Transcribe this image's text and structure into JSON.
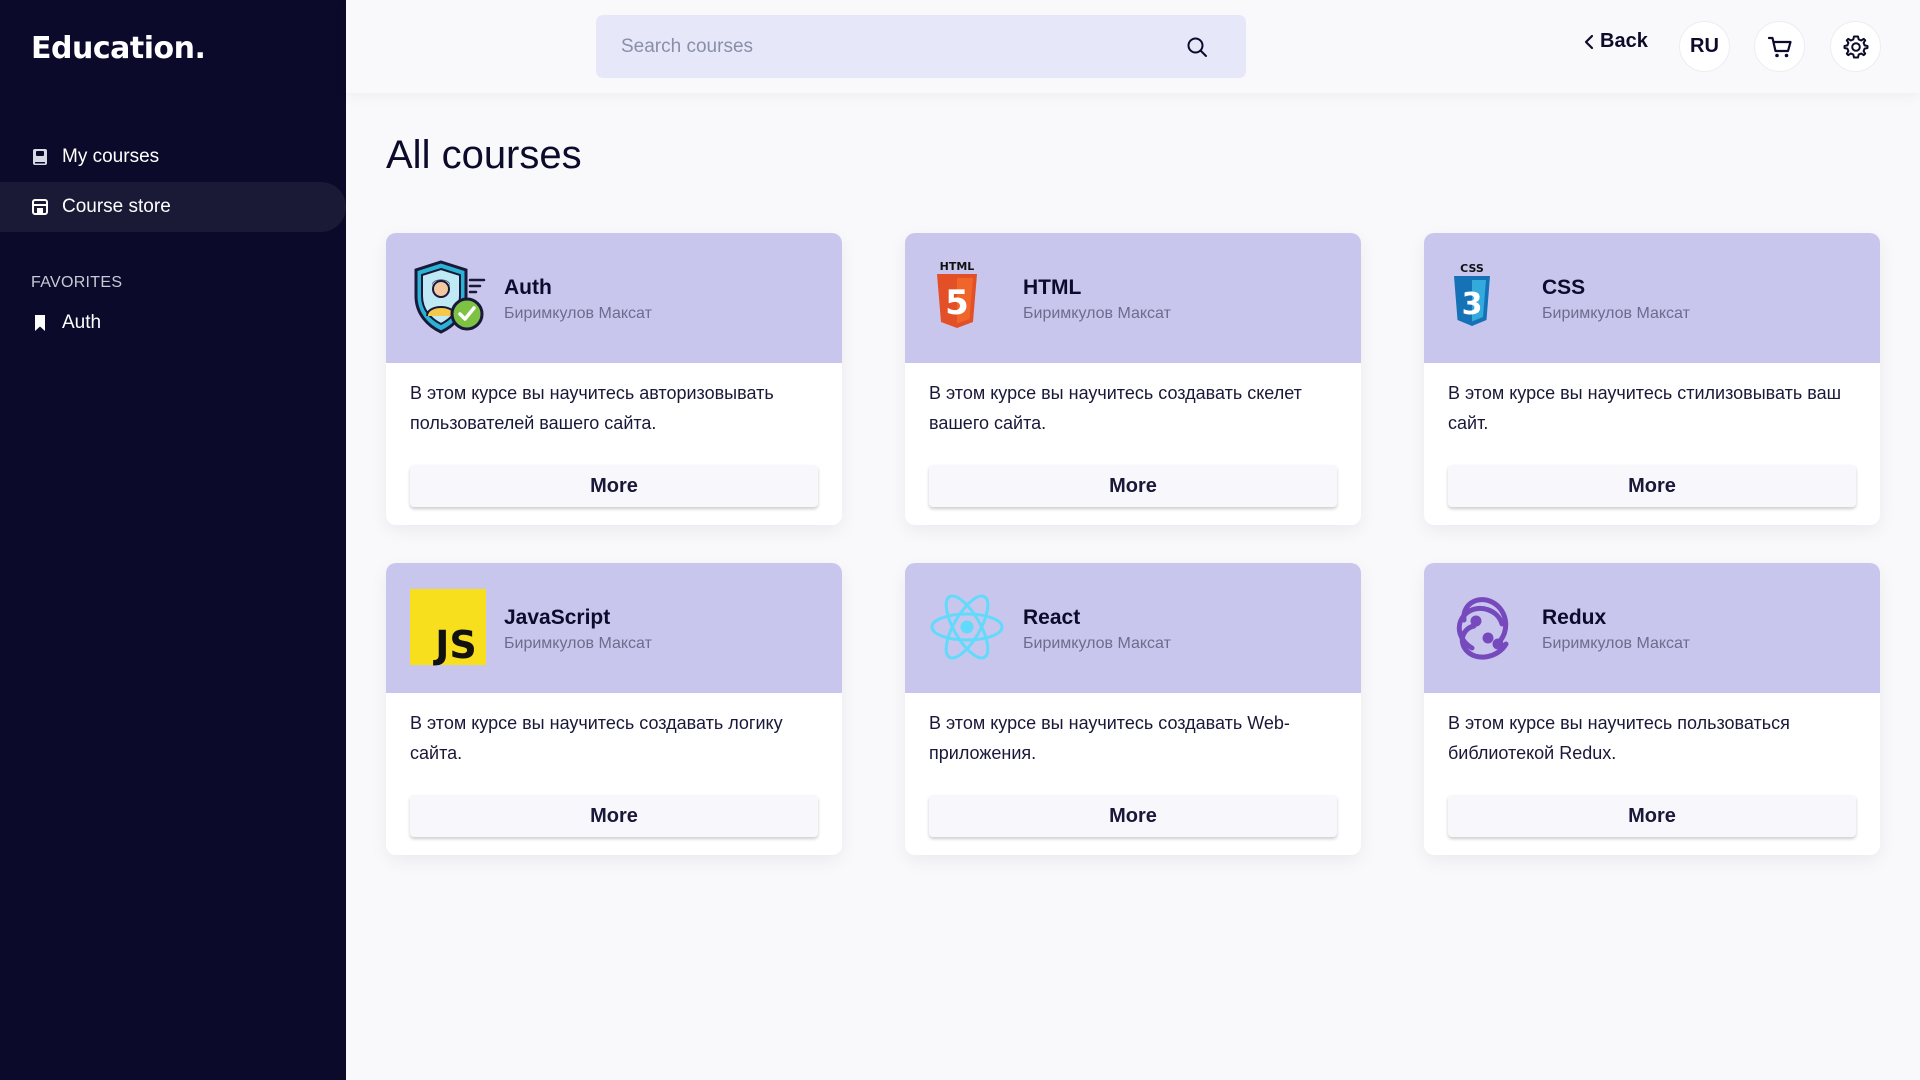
{
  "app": {
    "logo": "Education."
  },
  "sidebar": {
    "items": [
      {
        "label": "My courses",
        "icon": "book-icon"
      },
      {
        "label": "Course store",
        "icon": "store-icon",
        "active": true
      }
    ],
    "favorites_title": "FAVORITES",
    "favorites": [
      {
        "label": "Auth",
        "icon": "bookmark-icon"
      }
    ]
  },
  "header": {
    "search_placeholder": "Search courses",
    "back_label": "Back",
    "lang_label": "RU"
  },
  "main": {
    "title": "All courses",
    "more_label": "More",
    "courses": [
      {
        "title": "Auth",
        "author": "Биримкулов Максат",
        "description": "В этом курсе вы научитесь авторизовывать пользователей вашего сайта.",
        "icon": "auth-shield-icon"
      },
      {
        "title": "HTML",
        "author": "Биримкулов Максат",
        "description": "В этом курсе вы научитесь создавать скелет вашего сайта.",
        "icon": "html5-icon",
        "logo_caption": "HTML",
        "logo_numeral": "5"
      },
      {
        "title": "CSS",
        "author": "Биримкулов Максат",
        "description": "В этом курсе вы научитесь стилизовывать ваш сайт.",
        "icon": "css3-icon",
        "logo_caption": "CSS",
        "logo_numeral": "3"
      },
      {
        "title": "JavaScript",
        "author": "Биримкулов Максат",
        "description": "В этом курсе вы научитесь создавать логику сайта.",
        "icon": "javascript-icon",
        "logo_caption": "JS"
      },
      {
        "title": "React",
        "author": "Биримкулов Максат",
        "description": "В этом курсе вы научитесь создавать Web-приложения.",
        "icon": "react-icon"
      },
      {
        "title": "Redux",
        "author": "Биримкулов Максат",
        "description": "В этом курсе вы научитесь пользоваться библиотекой Redux.",
        "icon": "redux-icon"
      }
    ]
  },
  "colors": {
    "sidebar_bg": "#0b0a2a",
    "card_header": "#c9c6ee",
    "search_bg": "#e6e8fa"
  }
}
